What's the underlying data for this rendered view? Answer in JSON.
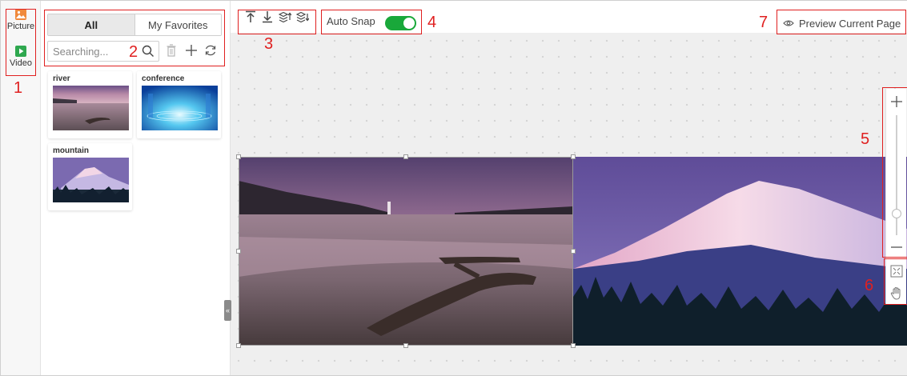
{
  "rail": {
    "items": [
      {
        "label": "Picture",
        "icon": "image-icon",
        "color": "#f08a3c"
      },
      {
        "label": "Video",
        "icon": "play-icon",
        "color": "#2fa84f"
      }
    ]
  },
  "panel": {
    "tabs": [
      {
        "label": "All",
        "active": true
      },
      {
        "label": "My Favorites",
        "active": false
      }
    ],
    "search": {
      "value": "",
      "placeholder": "Searching..."
    },
    "tools": [
      "delete-icon",
      "add-icon",
      "refresh-icon"
    ],
    "media": [
      {
        "name": "river"
      },
      {
        "name": "conference"
      },
      {
        "name": "mountain"
      }
    ]
  },
  "toolbar": {
    "align_icons": [
      "bring-to-top-icon",
      "send-to-bottom-icon",
      "bring-forward-icon",
      "send-backward-icon"
    ],
    "auto_snap_label": "Auto Snap",
    "auto_snap_on": true,
    "accent": "#19a83a",
    "preview_label": "Preview Current Page"
  },
  "zoom": {
    "level": 0.18
  },
  "annotations": {
    "labels": [
      "1",
      "2",
      "3",
      "4",
      "5",
      "6",
      "7"
    ],
    "color": "#e02020"
  }
}
